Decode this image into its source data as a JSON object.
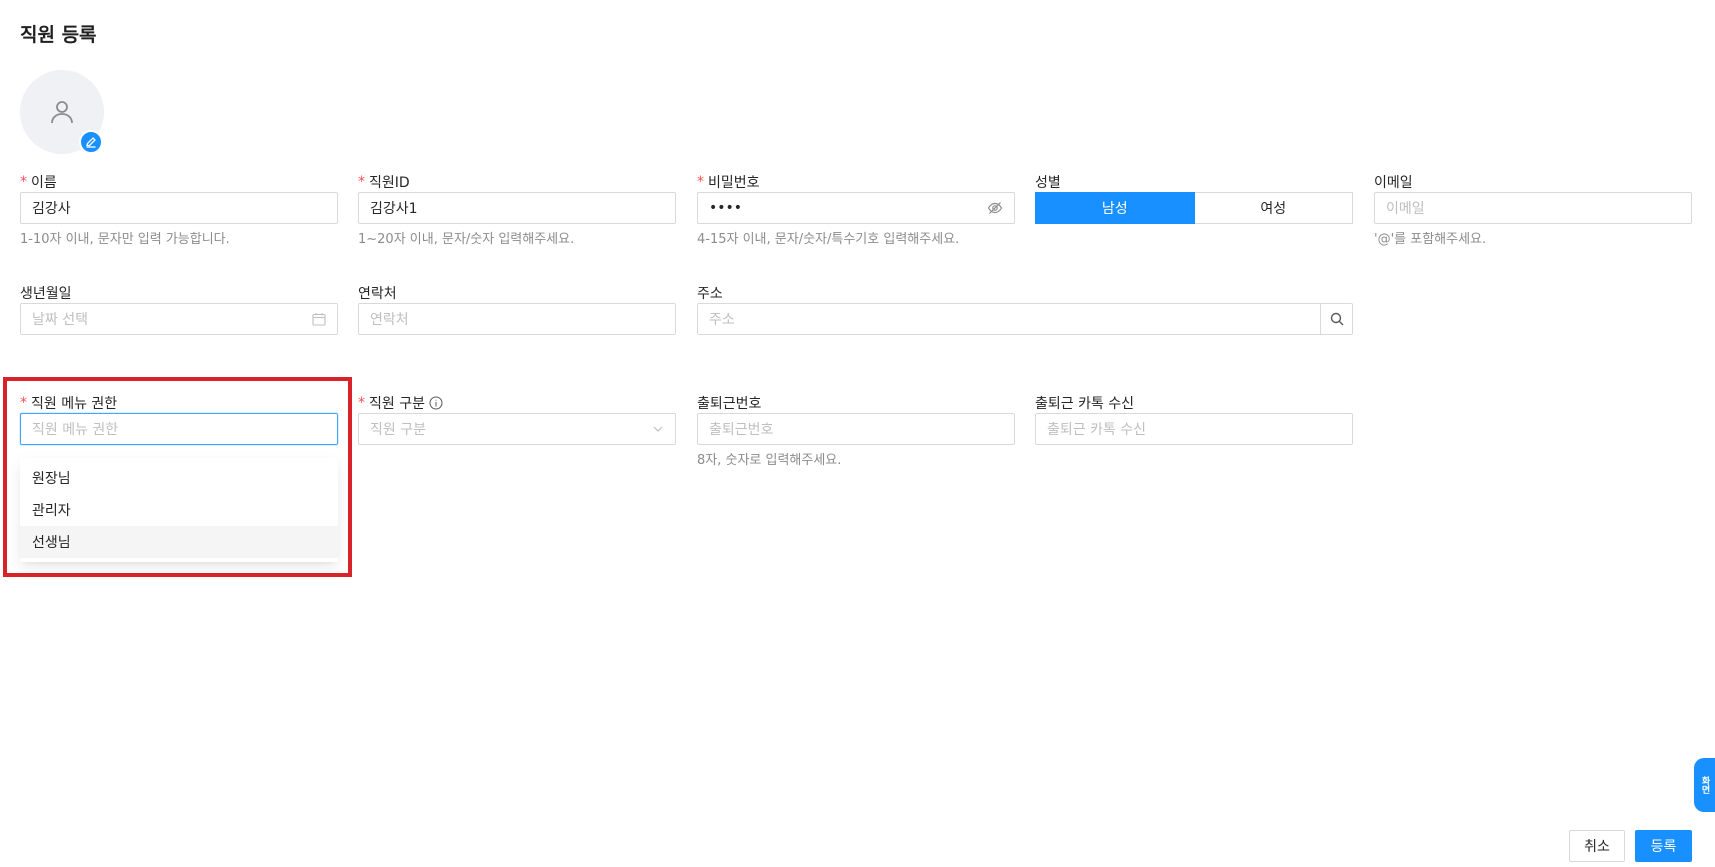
{
  "page": {
    "title": "직원 등록"
  },
  "avatar": {
    "icon": "person-icon",
    "edit_icon": "pencil-icon"
  },
  "fields": {
    "name": {
      "label": "이름",
      "required": true,
      "value": "김강사",
      "help": "1-10자 이내, 문자만 입력 가능합니다."
    },
    "staff_id": {
      "label": "직원ID",
      "required": true,
      "value": "김강사1",
      "help": "1~20자 이내, 문자/숫자 입력해주세요."
    },
    "password": {
      "label": "비밀번호",
      "required": true,
      "value": "••••",
      "help": "4-15자 이내, 문자/숫자/특수기호 입력해주세요.",
      "icon": "eye-off-icon"
    },
    "gender": {
      "label": "성별",
      "options": [
        "남성",
        "여성"
      ],
      "selected": "남성"
    },
    "email": {
      "label": "이메일",
      "placeholder": "이메일",
      "help": "'@'를 포함해주세요."
    },
    "birthdate": {
      "label": "생년월일",
      "placeholder": "날짜 선택",
      "icon": "calendar-icon"
    },
    "phone": {
      "label": "연락처",
      "placeholder": "연락처"
    },
    "address": {
      "label": "주소",
      "placeholder": "주소",
      "icon": "search-icon"
    },
    "menu_permission": {
      "label": "직원 메뉴 권한",
      "required": true,
      "placeholder": "직원 메뉴 권한",
      "options": [
        "원장님",
        "관리자",
        "선생님"
      ],
      "hovered": "선생님"
    },
    "staff_type": {
      "label": "직원 구분",
      "required": true,
      "placeholder": "직원 구분",
      "icon": "chevron-down-icon",
      "info_icon": "info-icon"
    },
    "attendance_no": {
      "label": "출퇴근번호",
      "placeholder": "출퇴근번호",
      "help": "8자, 숫자로 입력해주세요."
    },
    "attendance_kakao": {
      "label": "출퇴근 카톡 수신",
      "placeholder": "출퇴근 카톡 수신"
    }
  },
  "actions": {
    "cancel": "취소",
    "submit": "등록"
  },
  "side_tab": {
    "label": "화면"
  },
  "colors": {
    "primary": "#1890ff",
    "required": "#ff4d4f",
    "highlight": "#d9232a"
  }
}
